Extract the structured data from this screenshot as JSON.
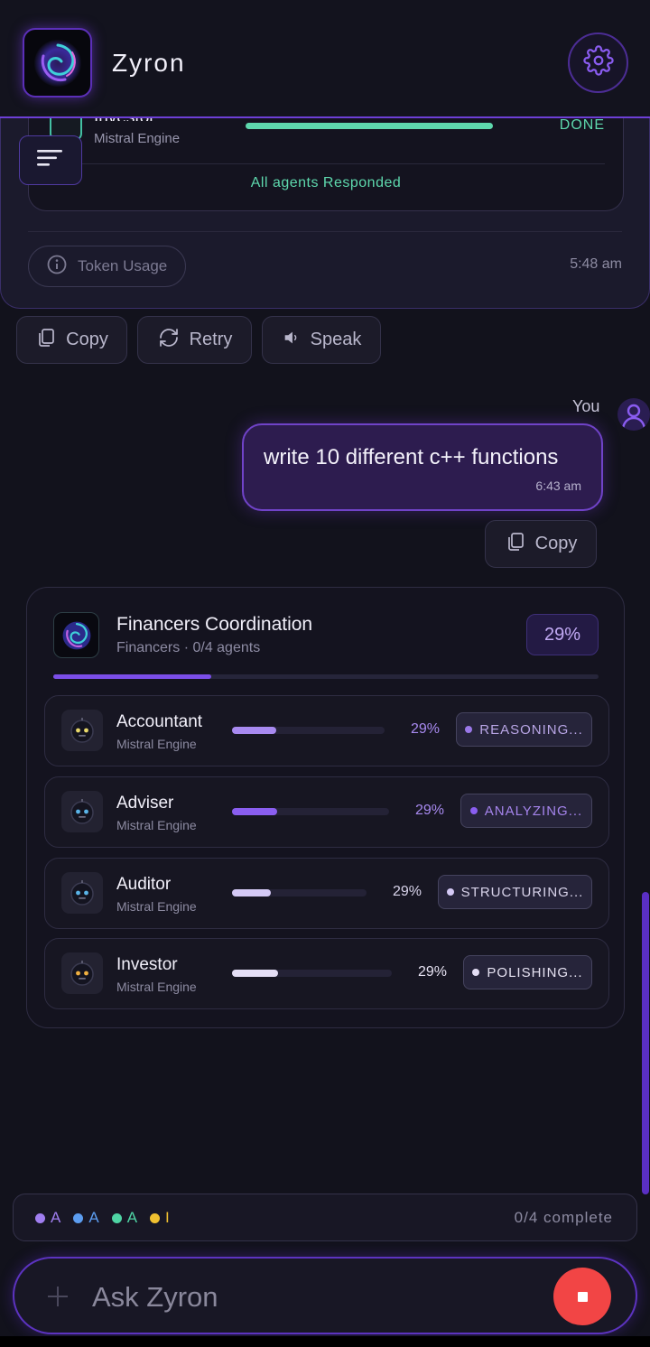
{
  "header": {
    "title": "Zyron"
  },
  "previous": {
    "agent_name": "Investor",
    "agent_engine": "Mistral Engine",
    "status": "DONE",
    "responded": "All agents Responded",
    "token_label": "Token Usage",
    "time": "5:48 am"
  },
  "actions": {
    "copy": "Copy",
    "retry": "Retry",
    "speak": "Speak"
  },
  "user_message": {
    "author": "You",
    "text": "write 10 different c++ functions",
    "time": "6:43 am",
    "copy": "Copy"
  },
  "coordination": {
    "title": "Financers Coordination",
    "subtitle": "Financers · 0/4 agents",
    "percent_label": "29%",
    "progress": 0.29,
    "agents": [
      {
        "name": "Accountant",
        "engine": "Mistral Engine",
        "percent": "29%",
        "progress": 0.29,
        "status": "REASONING...",
        "color": "#a88af0"
      },
      {
        "name": "Adviser",
        "engine": "Mistral Engine",
        "percent": "29%",
        "progress": 0.29,
        "status": "ANALYZING...",
        "color": "#8a5ef0"
      },
      {
        "name": "Auditor",
        "engine": "Mistral Engine",
        "percent": "29%",
        "progress": 0.29,
        "status": "STRUCTURING...",
        "color": "#d4c9f5"
      },
      {
        "name": "Investor",
        "engine": "Mistral Engine",
        "percent": "29%",
        "progress": 0.29,
        "status": "POLISHING...",
        "color": "#e4def5"
      }
    ]
  },
  "summary": {
    "items": [
      {
        "label": "A",
        "color": "#a07ef0"
      },
      {
        "label": "A",
        "color": "#5c9df0"
      },
      {
        "label": "A",
        "color": "#4fd4a4"
      },
      {
        "label": "I",
        "color": "#f0c030"
      }
    ],
    "count": "0/4 complete"
  },
  "input": {
    "placeholder": "Ask Zyron"
  },
  "colors": {
    "accent": "#6d3fd6",
    "success": "#5ed8ad",
    "stop": "#f24545"
  }
}
